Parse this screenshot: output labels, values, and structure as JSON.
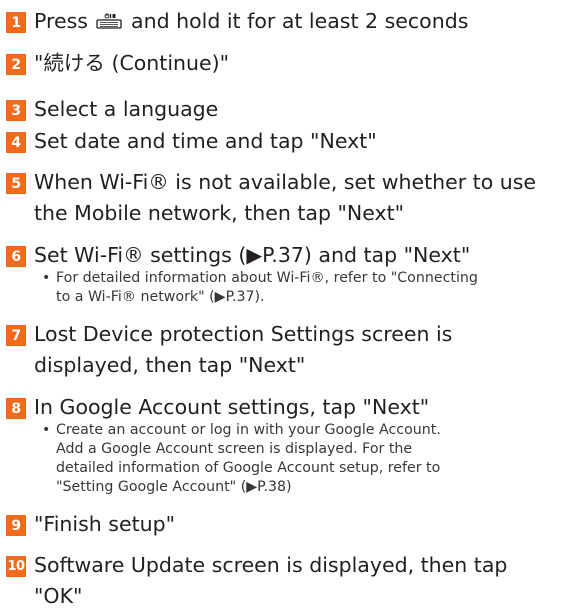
{
  "steps": [
    {
      "number": "1",
      "title_before_icon": "Press",
      "icon": "power-button-icon",
      "title_after_icon": "and hold it for at least 2 seconds"
    },
    {
      "number": "2",
      "title": "\"続ける (Continue)\""
    },
    {
      "number": "3",
      "title": "Select a language"
    },
    {
      "number": "4",
      "title": "Set date and time and tap \"Next\""
    },
    {
      "number": "5",
      "title_lines": [
        "When Wi-Fi® is not available, set whether to use",
        "the Mobile network, then tap \"Next\""
      ]
    },
    {
      "number": "6",
      "title": "Set Wi-Fi® settings (▶P.37) and tap \"Next\"",
      "notes": [
        {
          "bullet": "•",
          "lines": [
            "For detailed information about Wi-Fi®, refer to \"Connecting",
            "to a Wi-Fi® network\" (▶P.37)."
          ]
        }
      ]
    },
    {
      "number": "7",
      "title_lines": [
        "Lost Device protection Settings screen is",
        "displayed, then tap \"Next\""
      ]
    },
    {
      "number": "8",
      "title": "In Google Account settings, tap \"Next\"",
      "notes": [
        {
          "bullet": "•",
          "lines": [
            "Create an account or log in with your Google Account.",
            "Add a Google Account screen is displayed. For the",
            "detailed information of Google Account setup, refer to",
            "\"Setting Google Account\" (▶P.38)"
          ]
        }
      ]
    },
    {
      "number": "9",
      "title": "\"Finish setup\""
    },
    {
      "number": "10",
      "title_lines": [
        "Software Update screen is displayed, then tap",
        "\"OK\""
      ]
    }
  ],
  "colors": {
    "accent": "#f26a1b",
    "text": "#231f20"
  }
}
